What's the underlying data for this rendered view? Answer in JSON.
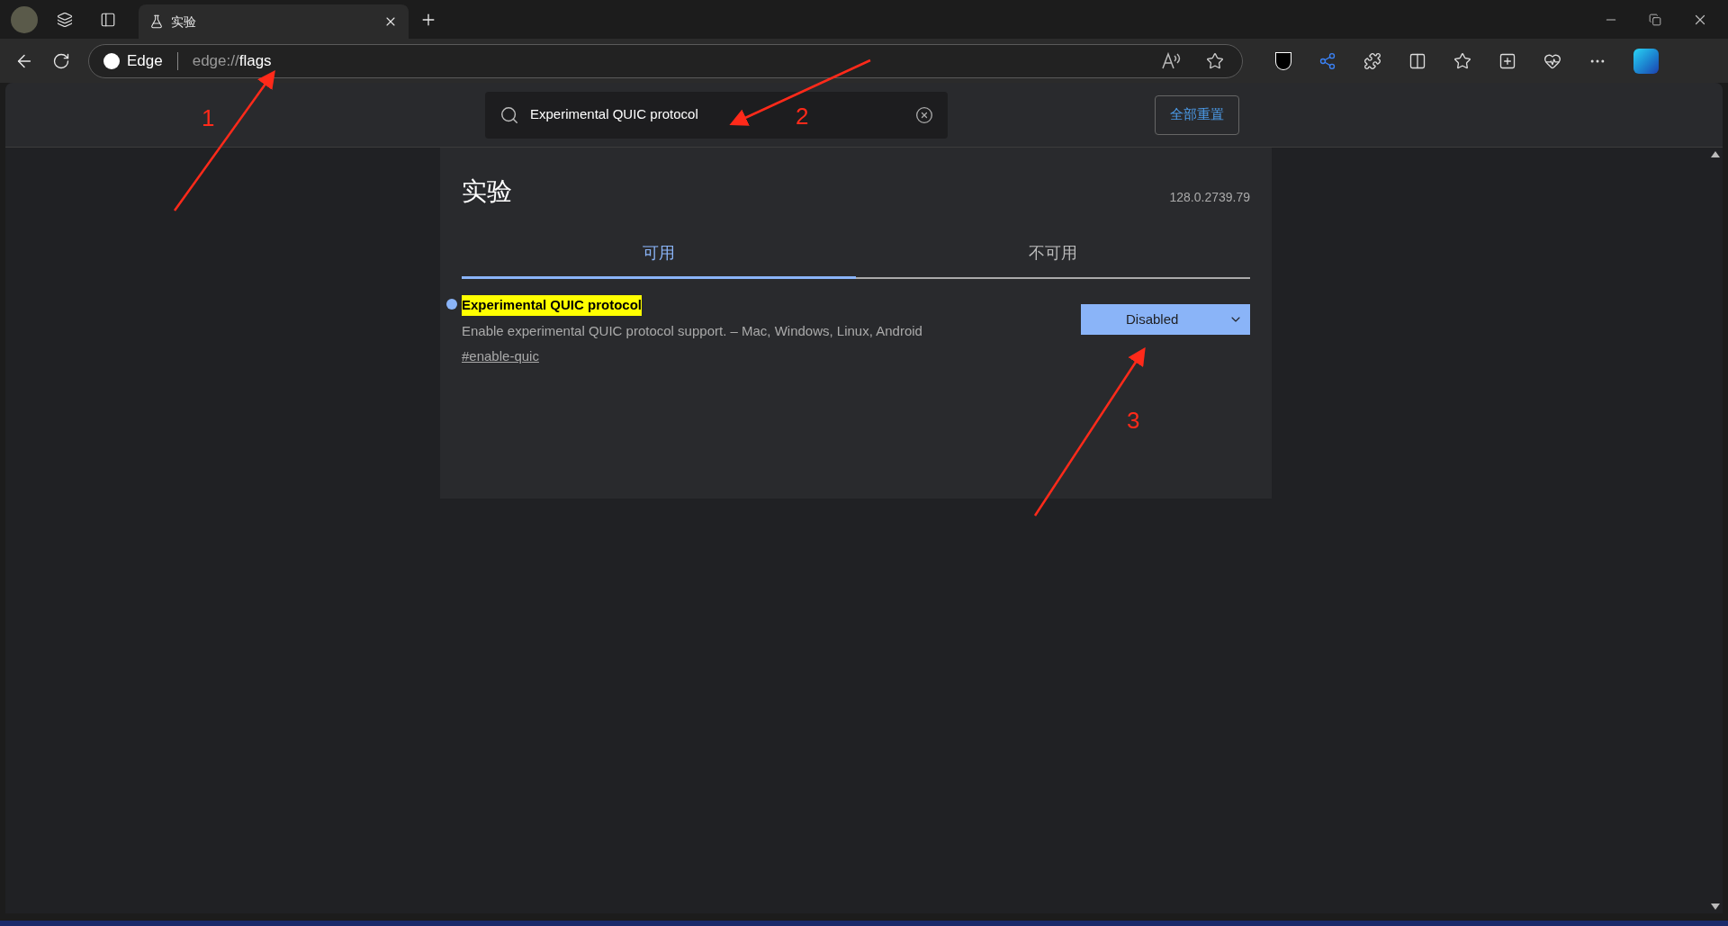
{
  "browser": {
    "tabs": [
      {
        "title": "实验",
        "selected": true
      }
    ],
    "address_bar": {
      "site_label": "Edge",
      "url_prefix": "edge://",
      "url_path": "flags"
    }
  },
  "flags_page": {
    "search": {
      "value": "Experimental QUIC protocol"
    },
    "reset_button": "全部重置",
    "title": "实验",
    "version": "128.0.2739.79",
    "tabs": [
      {
        "label": "可用",
        "selected": true
      },
      {
        "label": "不可用",
        "selected": false
      }
    ],
    "experiments": [
      {
        "name": "Experimental QUIC protocol",
        "highlighted": true,
        "modified": true,
        "description": "Enable experimental QUIC protocol support. – Mac, Windows, Linux, Android",
        "link": "#enable-quic",
        "value": "Disabled"
      }
    ]
  },
  "annotations": [
    {
      "label": "1"
    },
    {
      "label": "2"
    },
    {
      "label": "3"
    }
  ]
}
